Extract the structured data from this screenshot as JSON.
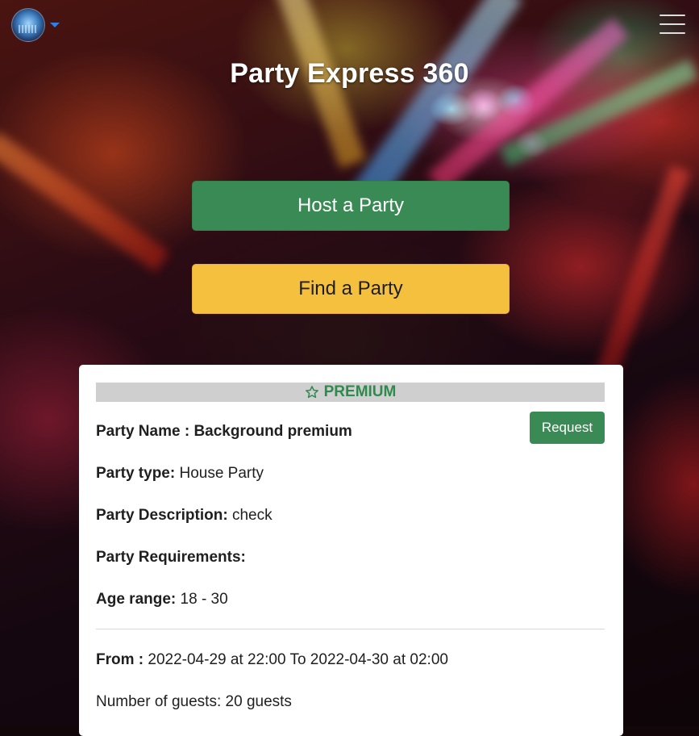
{
  "header": {
    "title": "Party Express 360",
    "avatar_icon": "user-avatar-icon",
    "menu_icon": "hamburger-menu-icon"
  },
  "actions": {
    "host_label": "Host a Party",
    "find_label": "Find a Party"
  },
  "card": {
    "badge": "PREMIUM",
    "badge_icon": "star-outline-icon",
    "request_label": "Request",
    "party_name_label": "Party Name : ",
    "party_name": "Background premium",
    "party_type_label": "Party type:",
    "party_type": "House Party",
    "description_label": "Party Description:",
    "description": "check",
    "requirements_label": "Party Requirements:",
    "requirements": "",
    "age_label": "Age range:",
    "age_range": "18 - 30",
    "from_label": "From : ",
    "schedule": "2022-04-29 at 22:00 To 2022-04-30 at 02:00",
    "guests_label": "Number of guests: ",
    "guests": "20 guests"
  },
  "colors": {
    "green": "#3a8a55",
    "yellow": "#f6c03f",
    "premium_text": "#2f8a4e",
    "caret": "#2f7ee6"
  }
}
